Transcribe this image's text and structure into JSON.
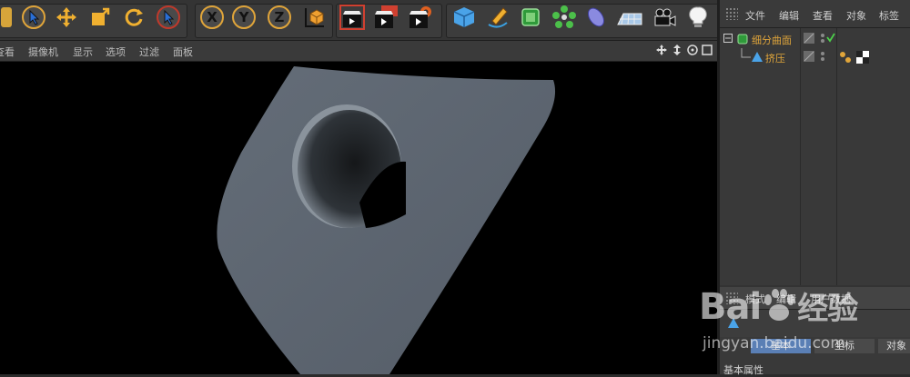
{
  "viewport_menu": {
    "items": [
      "查看",
      "摄像机",
      "显示",
      "选项",
      "过滤",
      "面板"
    ]
  },
  "toolbar": {
    "axis_x": "X",
    "axis_y": "Y",
    "axis_z": "Z",
    "icons": [
      "live-selection-icon",
      "move-icon",
      "scale-icon",
      "rotate-icon",
      "recent-tool-icon",
      "x-axis-lock-icon",
      "y-axis-lock-icon",
      "z-axis-lock-icon",
      "coordinate-system-icon",
      "render-view-icon",
      "render-picture-viewer-icon",
      "render-settings-icon",
      "cube-primitive-icon",
      "pen-spline-icon",
      "subdivision-surface-icon",
      "array-icon",
      "deformer-icon",
      "floor-scene-icon",
      "camera-icon",
      "light-icon"
    ]
  },
  "object_manager": {
    "menu": [
      "文件",
      "编辑",
      "查看",
      "对象",
      "标签"
    ],
    "objects": [
      {
        "name": "细分曲面",
        "color": "#e0a53a",
        "checked": true
      },
      {
        "name": "挤压",
        "color": "#e0a53a"
      }
    ]
  },
  "attributes": {
    "tabs": [
      "模式",
      "编辑",
      "用户数据"
    ],
    "mode_row": [
      "基本",
      "坐标",
      "对象"
    ],
    "section_title": "基本属性"
  },
  "watermark": {
    "brand": "Bai",
    "brand_tail": "经验",
    "url": "jingyan.baidu.com"
  },
  "colors": {
    "accent": "#e0a53a",
    "panel_bg": "#333333",
    "viewport_bg": "#000000",
    "mesh": "#5b6470"
  }
}
